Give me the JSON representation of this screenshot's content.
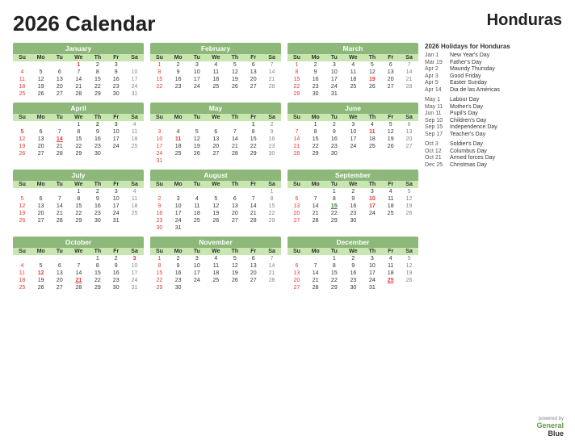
{
  "title": "2026 Calendar",
  "country": "Honduras",
  "holidays_title": "2026 Holidays for Honduras",
  "holidays": [
    {
      "date": "Jan 1",
      "name": "New Year's Day"
    },
    {
      "date": "Mar 19",
      "name": "Father's Day"
    },
    {
      "date": "Apr 2",
      "name": "Maundy Thursday"
    },
    {
      "date": "Apr 3",
      "name": "Good Friday"
    },
    {
      "date": "Apr 5",
      "name": "Easter Sunday"
    },
    {
      "date": "Apr 14",
      "name": "Dia de las Américas"
    },
    {
      "date": "May 1",
      "name": "Labour Day"
    },
    {
      "date": "May 11",
      "name": "Mother's Day"
    },
    {
      "date": "Jun 11",
      "name": "Pupil's Day"
    },
    {
      "date": "Sep 10",
      "name": "Children's Day"
    },
    {
      "date": "Sep 15",
      "name": "Independence Day"
    },
    {
      "date": "Sep 17",
      "name": "Teacher's Day"
    },
    {
      "date": "Oct 3",
      "name": "Soldier's Day"
    },
    {
      "date": "Oct 12",
      "name": "Columbus Day"
    },
    {
      "date": "Oct 21",
      "name": "Armed forces Day"
    },
    {
      "date": "Dec 25",
      "name": "Christmas Day"
    }
  ],
  "powered_label": "powered by",
  "brand_general": "General",
  "brand_blue": "Blue",
  "months": [
    {
      "name": "January",
      "weeks": [
        [
          "",
          "",
          "",
          "1",
          "2",
          "3"
        ],
        [
          "4",
          "5",
          "6",
          "7",
          "8",
          "9",
          "10"
        ],
        [
          "11",
          "12",
          "13",
          "14",
          "15",
          "16",
          "17"
        ],
        [
          "18",
          "19",
          "20",
          "21",
          "22",
          "23",
          "24"
        ],
        [
          "25",
          "26",
          "27",
          "28",
          "29",
          "30",
          "31"
        ]
      ],
      "holidays_red": [
        "1"
      ],
      "holidays_green": []
    },
    {
      "name": "February",
      "weeks": [
        [
          "1",
          "2",
          "3",
          "4",
          "5",
          "6",
          "7"
        ],
        [
          "8",
          "9",
          "10",
          "11",
          "12",
          "13",
          "14"
        ],
        [
          "15",
          "16",
          "17",
          "18",
          "19",
          "20",
          "21"
        ],
        [
          "22",
          "23",
          "24",
          "25",
          "26",
          "27",
          "28"
        ]
      ],
      "holidays_red": [],
      "holidays_green": []
    },
    {
      "name": "March",
      "weeks": [
        [
          "1",
          "2",
          "3",
          "4",
          "5",
          "6",
          "7"
        ],
        [
          "8",
          "9",
          "10",
          "11",
          "12",
          "13",
          "14"
        ],
        [
          "15",
          "16",
          "17",
          "18",
          "19",
          "20",
          "21"
        ],
        [
          "22",
          "23",
          "24",
          "25",
          "26",
          "27",
          "28"
        ],
        [
          "29",
          "30",
          "31",
          "",
          "",
          "",
          ""
        ]
      ],
      "holidays_red": [
        "19"
      ],
      "holidays_green": []
    },
    {
      "name": "April",
      "weeks": [
        [
          "",
          "",
          "",
          "1",
          "2",
          "3",
          "4"
        ],
        [
          "5",
          "6",
          "7",
          "8",
          "9",
          "10",
          "11"
        ],
        [
          "12",
          "13",
          "14",
          "15",
          "16",
          "17",
          "18"
        ],
        [
          "19",
          "20",
          "21",
          "22",
          "23",
          "24",
          "25"
        ],
        [
          "26",
          "27",
          "28",
          "29",
          "30",
          "",
          ""
        ]
      ],
      "holidays_red": [
        "5",
        "14"
      ],
      "holidays_green": [
        "2",
        "3"
      ]
    },
    {
      "name": "May",
      "weeks": [
        [
          "",
          "",
          "",
          "",
          "",
          "1",
          "2"
        ],
        [
          "3",
          "4",
          "5",
          "6",
          "7",
          "8",
          "9"
        ],
        [
          "10",
          "11",
          "12",
          "13",
          "14",
          "15",
          "16"
        ],
        [
          "17",
          "18",
          "19",
          "20",
          "21",
          "22",
          "23"
        ],
        [
          "24",
          "25",
          "26",
          "27",
          "28",
          "29",
          "30"
        ],
        [
          "31",
          "",
          "",
          "",
          "",
          "",
          ""
        ]
      ],
      "holidays_red": [
        "11"
      ],
      "holidays_green": [
        "1"
      ]
    },
    {
      "name": "June",
      "weeks": [
        [
          "",
          "1",
          "2",
          "3",
          "4",
          "5",
          "6"
        ],
        [
          "7",
          "8",
          "9",
          "10",
          "11",
          "12",
          "13"
        ],
        [
          "14",
          "15",
          "16",
          "17",
          "18",
          "19",
          "20"
        ],
        [
          "21",
          "22",
          "23",
          "24",
          "25",
          "26",
          "27"
        ],
        [
          "28",
          "29",
          "30",
          "",
          "",
          "",
          ""
        ]
      ],
      "holidays_red": [
        "11"
      ],
      "holidays_green": []
    },
    {
      "name": "July",
      "weeks": [
        [
          "",
          "",
          "",
          "1",
          "2",
          "3",
          "4"
        ],
        [
          "5",
          "6",
          "7",
          "8",
          "9",
          "10",
          "11"
        ],
        [
          "12",
          "13",
          "14",
          "15",
          "16",
          "17",
          "18"
        ],
        [
          "19",
          "20",
          "21",
          "22",
          "23",
          "24",
          "25"
        ],
        [
          "26",
          "27",
          "28",
          "29",
          "30",
          "31",
          ""
        ]
      ],
      "holidays_red": [],
      "holidays_green": []
    },
    {
      "name": "August",
      "weeks": [
        [
          "",
          "",
          "",
          "",
          "",
          "",
          "1"
        ],
        [
          "2",
          "3",
          "4",
          "5",
          "6",
          "7",
          "8"
        ],
        [
          "9",
          "10",
          "11",
          "12",
          "13",
          "14",
          "15"
        ],
        [
          "16",
          "17",
          "18",
          "19",
          "20",
          "21",
          "22"
        ],
        [
          "23",
          "24",
          "25",
          "26",
          "27",
          "28",
          "29"
        ],
        [
          "30",
          "31",
          "",
          "",
          "",
          "",
          ""
        ]
      ],
      "holidays_red": [],
      "holidays_green": []
    },
    {
      "name": "September",
      "weeks": [
        [
          "",
          "",
          "1",
          "2",
          "3",
          "4",
          "5"
        ],
        [
          "6",
          "7",
          "8",
          "9",
          "10",
          "11",
          "12"
        ],
        [
          "13",
          "14",
          "15",
          "16",
          "17",
          "18",
          "19"
        ],
        [
          "20",
          "21",
          "22",
          "23",
          "24",
          "25",
          "26"
        ],
        [
          "27",
          "28",
          "29",
          "30",
          "",
          "",
          ""
        ]
      ],
      "holidays_red": [
        "10",
        "17"
      ],
      "holidays_green": [
        "15"
      ]
    },
    {
      "name": "October",
      "weeks": [
        [
          "",
          "",
          "",
          "",
          "1",
          "2",
          "3"
        ],
        [
          "4",
          "5",
          "6",
          "7",
          "8",
          "9",
          "10"
        ],
        [
          "11",
          "12",
          "13",
          "14",
          "15",
          "16",
          "17"
        ],
        [
          "18",
          "19",
          "20",
          "21",
          "22",
          "23",
          "24"
        ],
        [
          "25",
          "26",
          "27",
          "28",
          "29",
          "30",
          "31"
        ]
      ],
      "holidays_red": [
        "3",
        "12",
        "21"
      ],
      "holidays_green": []
    },
    {
      "name": "November",
      "weeks": [
        [
          "1",
          "2",
          "3",
          "4",
          "5",
          "6",
          "7"
        ],
        [
          "8",
          "9",
          "10",
          "11",
          "12",
          "13",
          "14"
        ],
        [
          "15",
          "16",
          "17",
          "18",
          "19",
          "20",
          "21"
        ],
        [
          "22",
          "23",
          "24",
          "25",
          "26",
          "27",
          "28"
        ],
        [
          "29",
          "30",
          "",
          "",
          "",
          "",
          ""
        ]
      ],
      "holidays_red": [],
      "holidays_green": []
    },
    {
      "name": "December",
      "weeks": [
        [
          "",
          "",
          "1",
          "2",
          "3",
          "4",
          "5"
        ],
        [
          "6",
          "7",
          "8",
          "9",
          "10",
          "11",
          "12"
        ],
        [
          "13",
          "14",
          "15",
          "16",
          "17",
          "18",
          "19"
        ],
        [
          "20",
          "21",
          "22",
          "23",
          "24",
          "25",
          "26"
        ],
        [
          "27",
          "28",
          "29",
          "30",
          "31",
          "",
          ""
        ]
      ],
      "holidays_red": [
        "25"
      ],
      "holidays_green": []
    }
  ]
}
